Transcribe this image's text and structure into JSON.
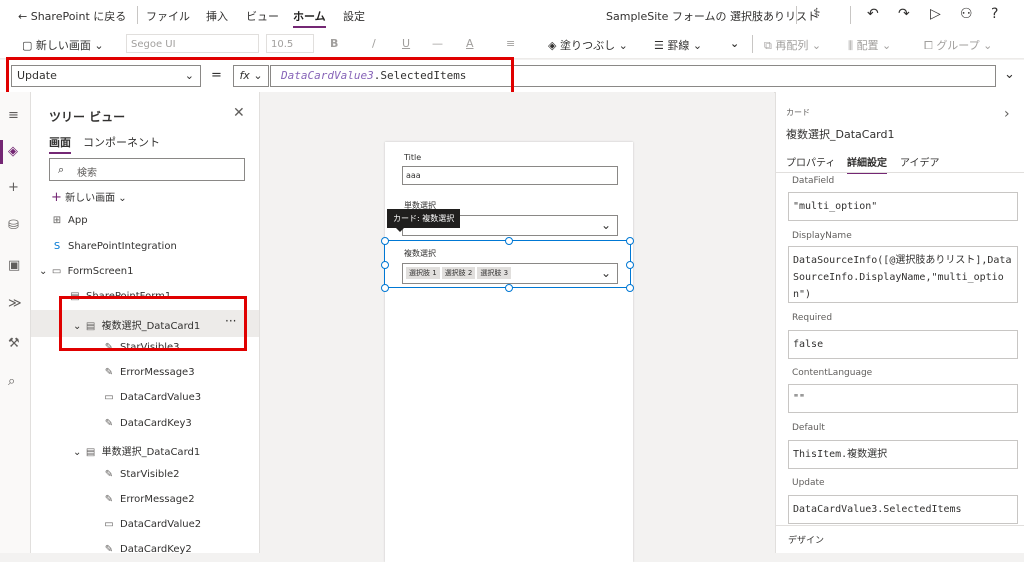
{
  "topbar": {
    "back_label": "SharePoint に戻る",
    "menus": [
      "ファイル",
      "挿入",
      "ビュー",
      "ホーム",
      "設定"
    ],
    "active_menu": "ホーム",
    "app_title": "SampleSite フォームの 選択肢ありリスト"
  },
  "ribbon": {
    "new_screen": "新しい画面",
    "font": "Segoe UI",
    "font_size": "10.5",
    "bold": "B",
    "italic": "/",
    "underline": "U",
    "strike": "—",
    "font_color": "A",
    "fill": "塗りつぶし",
    "border": "罫線",
    "reorder": "再配列",
    "align": "配置",
    "group": "グループ"
  },
  "formula_bar": {
    "property": "Update",
    "equals": "=",
    "fx": "fx",
    "formula_var": "DataCardValue3",
    "formula_rest": ".SelectedItems"
  },
  "tree": {
    "title": "ツリー ビュー",
    "tabs": [
      "画面",
      "コンポーネント"
    ],
    "search_placeholder": "検索",
    "new_screen": "新しい画面",
    "nodes": {
      "app": "App",
      "integration": "SharePointIntegration",
      "formscreen": "FormScreen1",
      "sharepointform": "SharePointForm1",
      "datacard_multi": "複数選択_DataCard1",
      "starvisible3": "StarVisible3",
      "errormessage3": "ErrorMessage3",
      "datacardvalue3": "DataCardValue3",
      "datacardkey3": "DataCardKey3",
      "datacard_single": "単数選択_DataCard1",
      "starvisible2": "StarVisible2",
      "errormessage2": "ErrorMessage2",
      "datacardvalue2": "DataCardValue2",
      "datacardkey2": "DataCardKey2"
    },
    "more": "···"
  },
  "canvas": {
    "title_label": "Title",
    "title_value": "aaa",
    "single_label": "単数選択",
    "tooltip": "カード: 複数選択",
    "multi_label": "複数選択",
    "chips": [
      "選択肢 1",
      "選択肢 2",
      "選択肢 3"
    ]
  },
  "properties": {
    "header_small": "カード",
    "header_title": "複数選択_DataCard1",
    "tabs": [
      "プロパティ",
      "詳細設定",
      "アイデア"
    ],
    "active_tab": "詳細設定",
    "fields": {
      "datafield_label": "DataField",
      "datafield_value": "\"multi_option\"",
      "displayname_label": "DisplayName",
      "displayname_value": "DataSourceInfo([@選択肢ありリスト],DataSourceInfo.DisplayName,\"multi_option\")",
      "required_label": "Required",
      "required_value": "false",
      "contentlanguage_label": "ContentLanguage",
      "contentlanguage_value": "\"\"",
      "default_label": "Default",
      "default_value": "ThisItem.複数選択",
      "update_label": "Update",
      "update_value": "DataCardValue3.SelectedItems"
    },
    "design_section": "デザイン"
  },
  "colors": {
    "accent": "#742774",
    "highlight_red": "#e00000",
    "selection_blue": "#0078d4"
  }
}
